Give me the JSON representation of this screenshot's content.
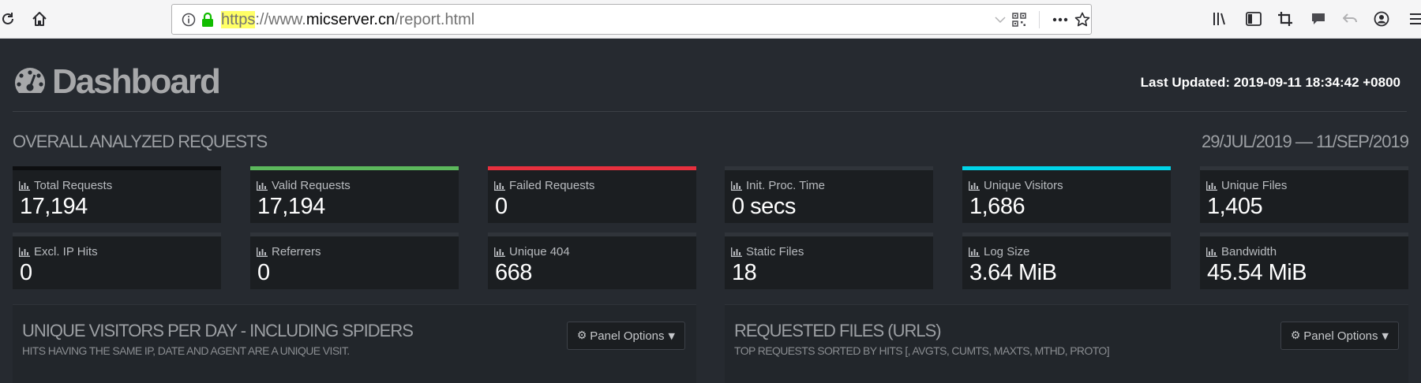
{
  "browser": {
    "url_protocol": "https",
    "url_sep": "://",
    "url_www": "www.",
    "url_host": "micserver.cn",
    "url_path": "/report.html"
  },
  "header": {
    "title": "Dashboard",
    "last_updated": "Last Updated: 2019-09-11 18:34:42 +0800"
  },
  "overall": {
    "title": "OVERALL ANALYZED REQUESTS",
    "date_range": "29/JUL/2019 — 11/SEP/2019",
    "cards": [
      {
        "label": "Total Requests",
        "value": "17,194",
        "accent": "#0d0e10"
      },
      {
        "label": "Valid Requests",
        "value": "17,194",
        "accent": "#5cb85c"
      },
      {
        "label": "Failed Requests",
        "value": "0",
        "accent": "#e7303e"
      },
      {
        "label": "Init. Proc. Time",
        "value": "0 secs",
        "accent": "#30343a"
      },
      {
        "label": "Unique Visitors",
        "value": "1,686",
        "accent": "#00d4e8"
      },
      {
        "label": "Unique Files",
        "value": "1,405",
        "accent": "#30343a"
      },
      {
        "label": "Excl. IP Hits",
        "value": "0",
        "accent": "#30343a"
      },
      {
        "label": "Referrers",
        "value": "0",
        "accent": "#30343a"
      },
      {
        "label": "Unique 404",
        "value": "668",
        "accent": "#30343a"
      },
      {
        "label": "Static Files",
        "value": "18",
        "accent": "#30343a"
      },
      {
        "label": "Log Size",
        "value": "3.64 MiB",
        "accent": "#30343a"
      },
      {
        "label": "Bandwidth",
        "value": "45.54 MiB",
        "accent": "#30343a"
      }
    ]
  },
  "panels": [
    {
      "title": "UNIQUE VISITORS PER DAY - INCLUDING SPIDERS",
      "subtitle": "HITS HAVING THE SAME IP, DATE AND AGENT ARE A UNIQUE VISIT.",
      "button": "Panel Options"
    },
    {
      "title": "REQUESTED FILES (URLS)",
      "subtitle": "TOP REQUESTS SORTED BY HITS [, AVGTS, CUMTS, MAXTS, MTHD, PROTO]",
      "button": "Panel Options"
    }
  ]
}
